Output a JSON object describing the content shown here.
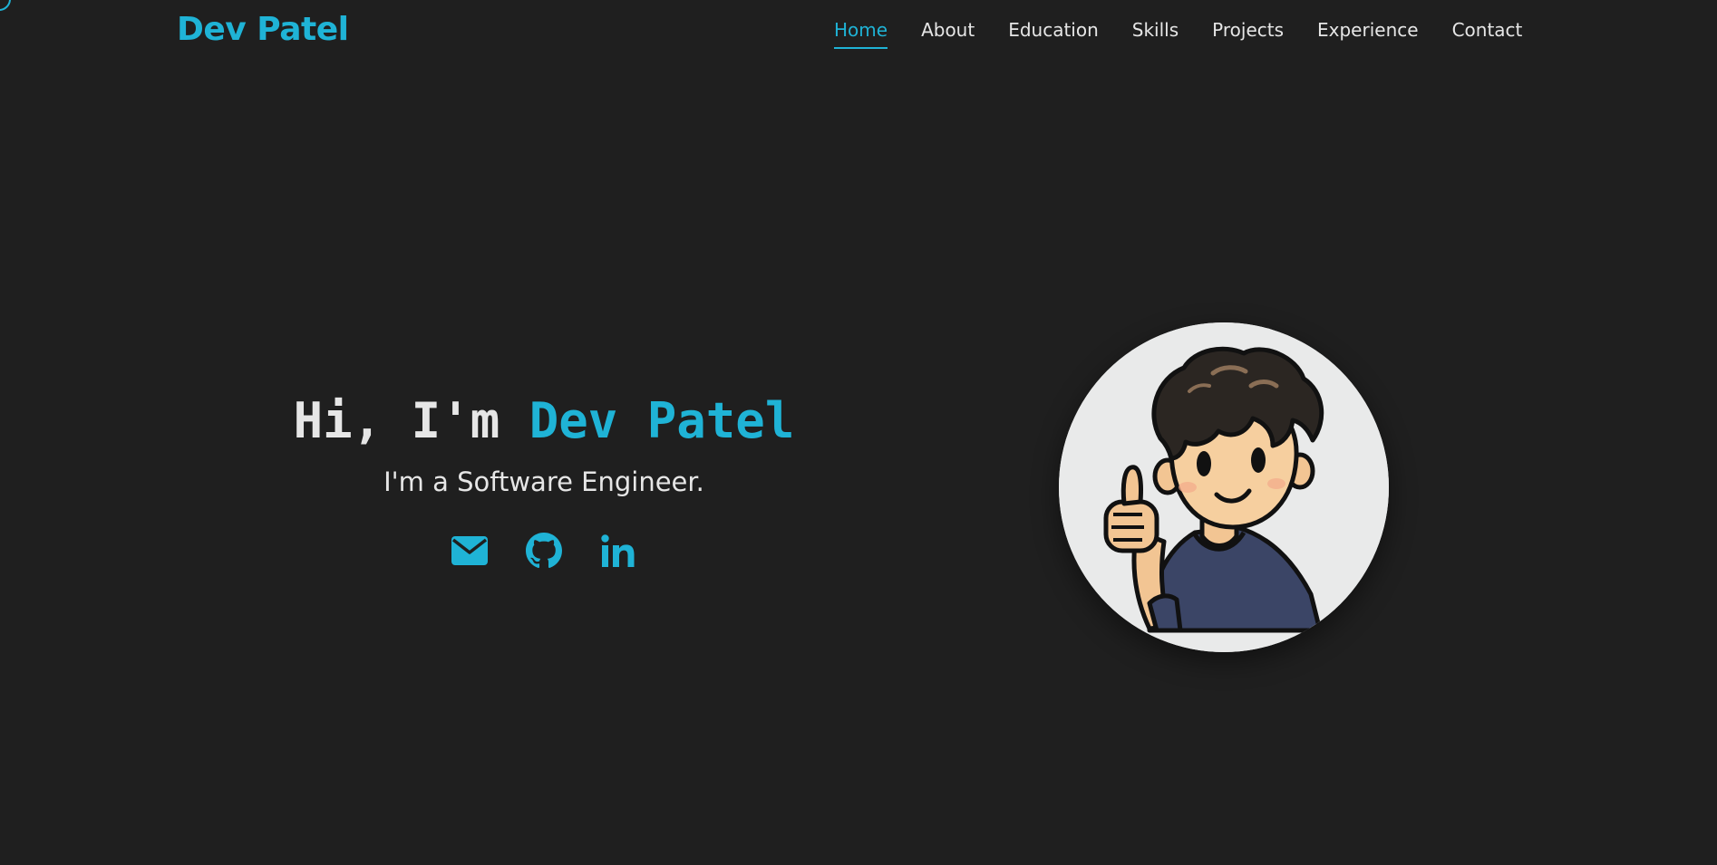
{
  "colors": {
    "accent": "#1fb3d6",
    "background": "#1f1f1f",
    "text": "#e6e6e6"
  },
  "navbar": {
    "logo": "Dev Patel",
    "links": [
      {
        "label": "Home",
        "active": true
      },
      {
        "label": "About",
        "active": false
      },
      {
        "label": "Education",
        "active": false
      },
      {
        "label": "Skills",
        "active": false
      },
      {
        "label": "Projects",
        "active": false
      },
      {
        "label": "Experience",
        "active": false
      },
      {
        "label": "Contact",
        "active": false
      }
    ]
  },
  "hero": {
    "greeting": "Hi, I'm ",
    "name": "Dev Patel",
    "subtitle": "I'm a Software Engineer.",
    "socials": [
      {
        "icon": "envelope-icon"
      },
      {
        "icon": "github-icon"
      },
      {
        "icon": "linkedin-icon"
      }
    ],
    "avatar_icon": "cartoon-boy-thumbs-up-avatar"
  }
}
